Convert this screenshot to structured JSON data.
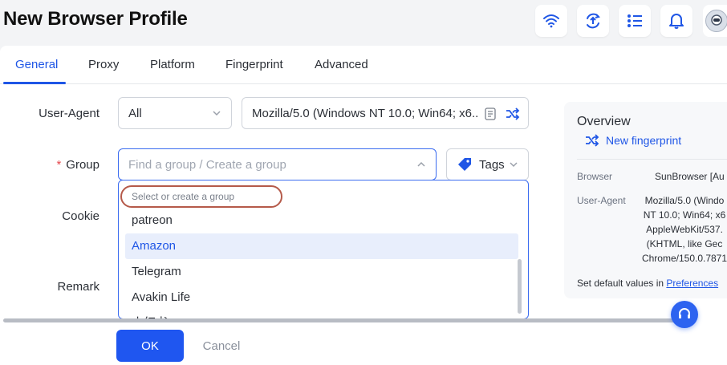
{
  "page": {
    "title": "New Browser Profile"
  },
  "tabs": [
    "General",
    "Proxy",
    "Platform",
    "Fingerprint",
    "Advanced"
  ],
  "form": {
    "user_agent_label": "User-Agent",
    "user_agent_filter": "All",
    "user_agent_value": "Mozilla/5.0 (Windows NT 10.0; Win64; x6...",
    "group_label": "Group",
    "group_placeholder": "Find a group / Create a group",
    "tags_label": "Tags",
    "cookie_label": "Cookie",
    "remark_label": "Remark"
  },
  "dropdown": {
    "search_placeholder": "Select or create a group",
    "items": [
      "patreon",
      "Amazon",
      "Telegram",
      "Avakin Life",
      "小红书"
    ],
    "selected": "Amazon"
  },
  "overview": {
    "title": "Overview",
    "new_fingerprint": "New fingerprint",
    "browser_key": "Browser",
    "browser_value": "SunBrowser [Au",
    "ua_key": "User-Agent",
    "ua_value": "Mozilla/5.0 (Windo\nNT 10.0; Win64; x6\nAppleWebKit/537.\n(KHTML, like Gec\nChrome/150.0.7871",
    "footer_text": "Set default values in ",
    "footer_link": "Preferences"
  },
  "actions": {
    "ok": "OK",
    "cancel": "Cancel"
  },
  "colors": {
    "accent": "#1f56e6",
    "required": "#e5484d",
    "highlight": "#e8eefc"
  }
}
